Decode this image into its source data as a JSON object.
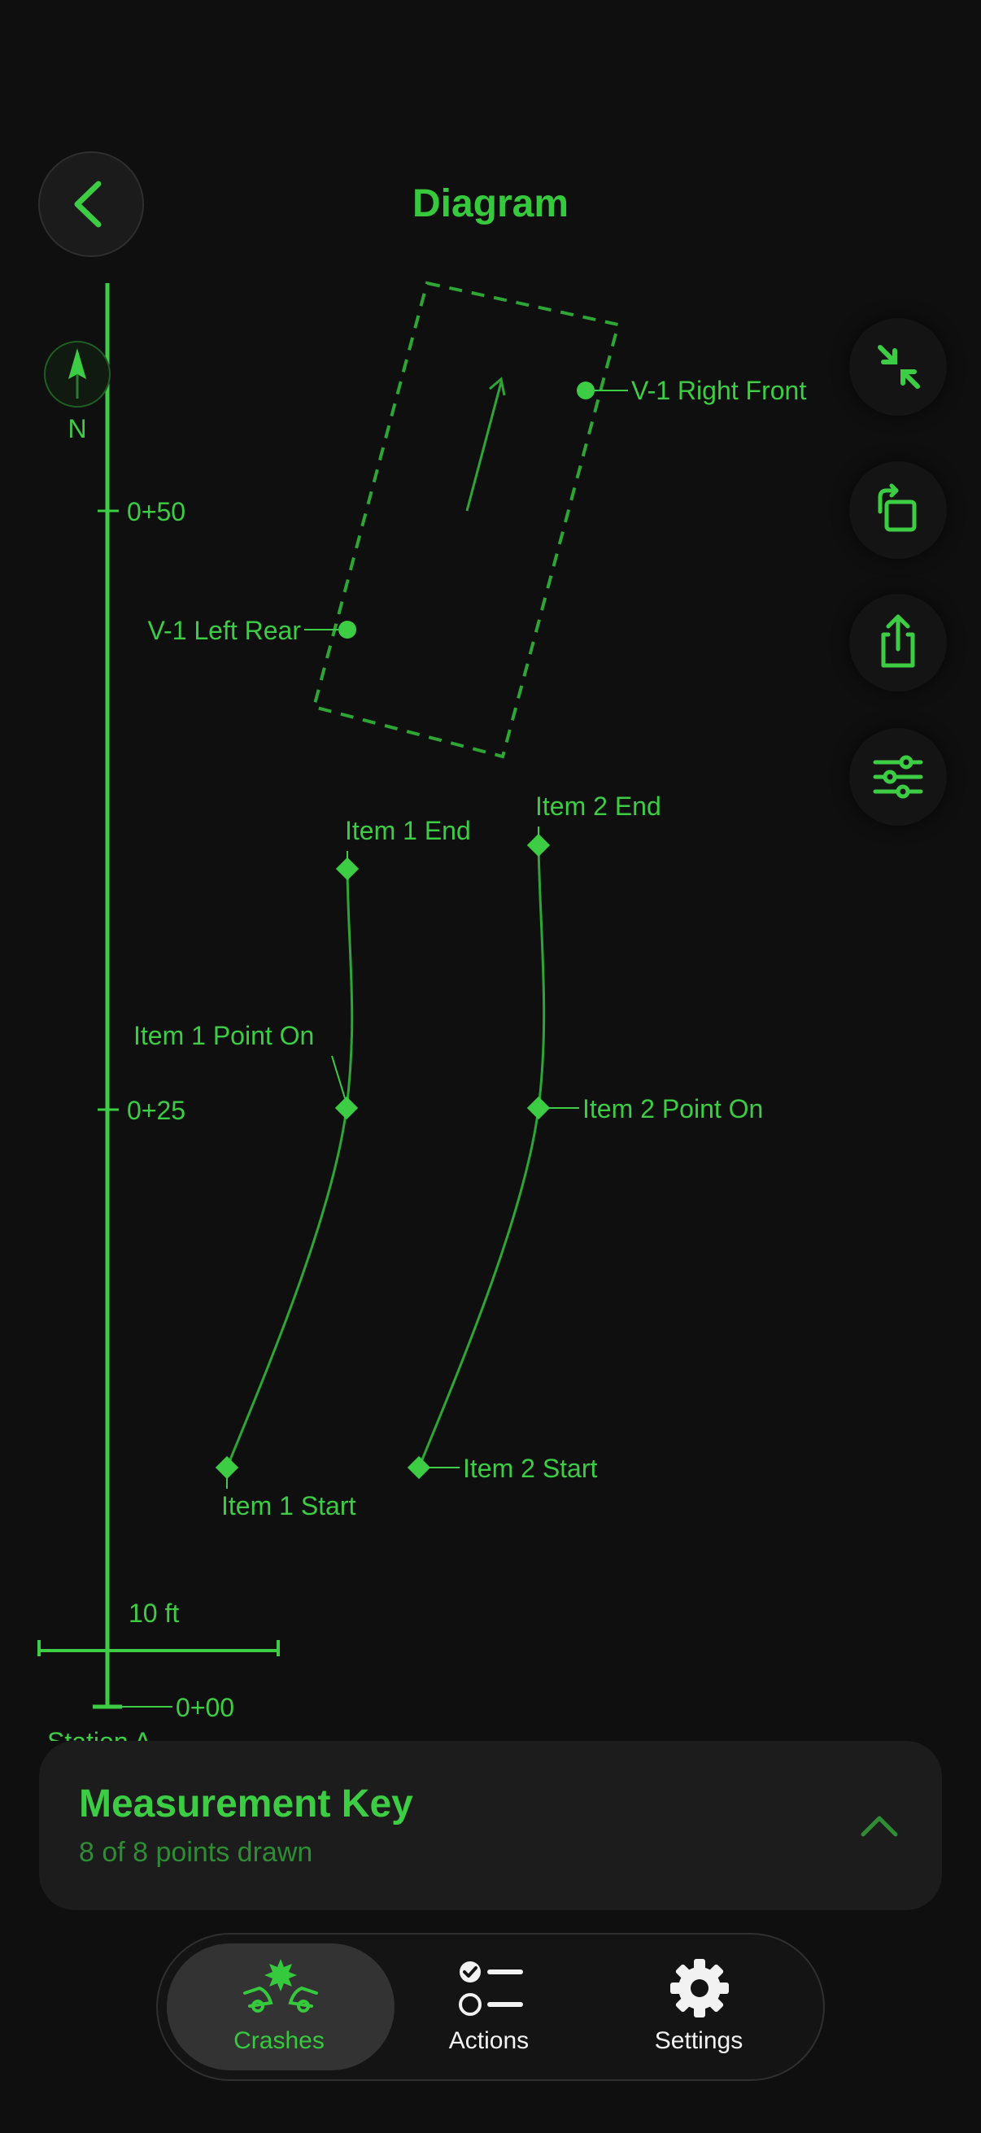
{
  "header": {
    "title": "Diagram"
  },
  "compass": {
    "label": "N"
  },
  "stations": {
    "mark_50": "0+50",
    "mark_25": "0+25",
    "mark_00": "0+00",
    "origin_label": "Station A"
  },
  "scale_bar": {
    "label": "10 ft"
  },
  "vehicle": {
    "right_front": "V-1 Right Front",
    "left_rear": "V-1 Left Rear"
  },
  "items": {
    "item1_end": "Item 1 End",
    "item1_point_on": "Item 1 Point On",
    "item1_start": "Item 1 Start",
    "item2_end": "Item 2 End",
    "item2_point_on": "Item 2 Point On",
    "item2_start": "Item 2 Start"
  },
  "toolbar": {
    "icons": [
      "collapse-icon",
      "rotate-icon",
      "share-icon",
      "sliders-icon"
    ]
  },
  "measurement_key": {
    "title": "Measurement Key",
    "subtitle": "8 of 8 points drawn"
  },
  "tabs": [
    {
      "label": "Crashes",
      "icon": "crash-icon",
      "active": true
    },
    {
      "label": "Actions",
      "icon": "checklist-icon",
      "active": false
    },
    {
      "label": "Settings",
      "icon": "gear-icon",
      "active": false
    }
  ],
  "colors": {
    "accent": "#36c93d",
    "background": "#0f0f0f",
    "card": "#1c1c1c"
  }
}
